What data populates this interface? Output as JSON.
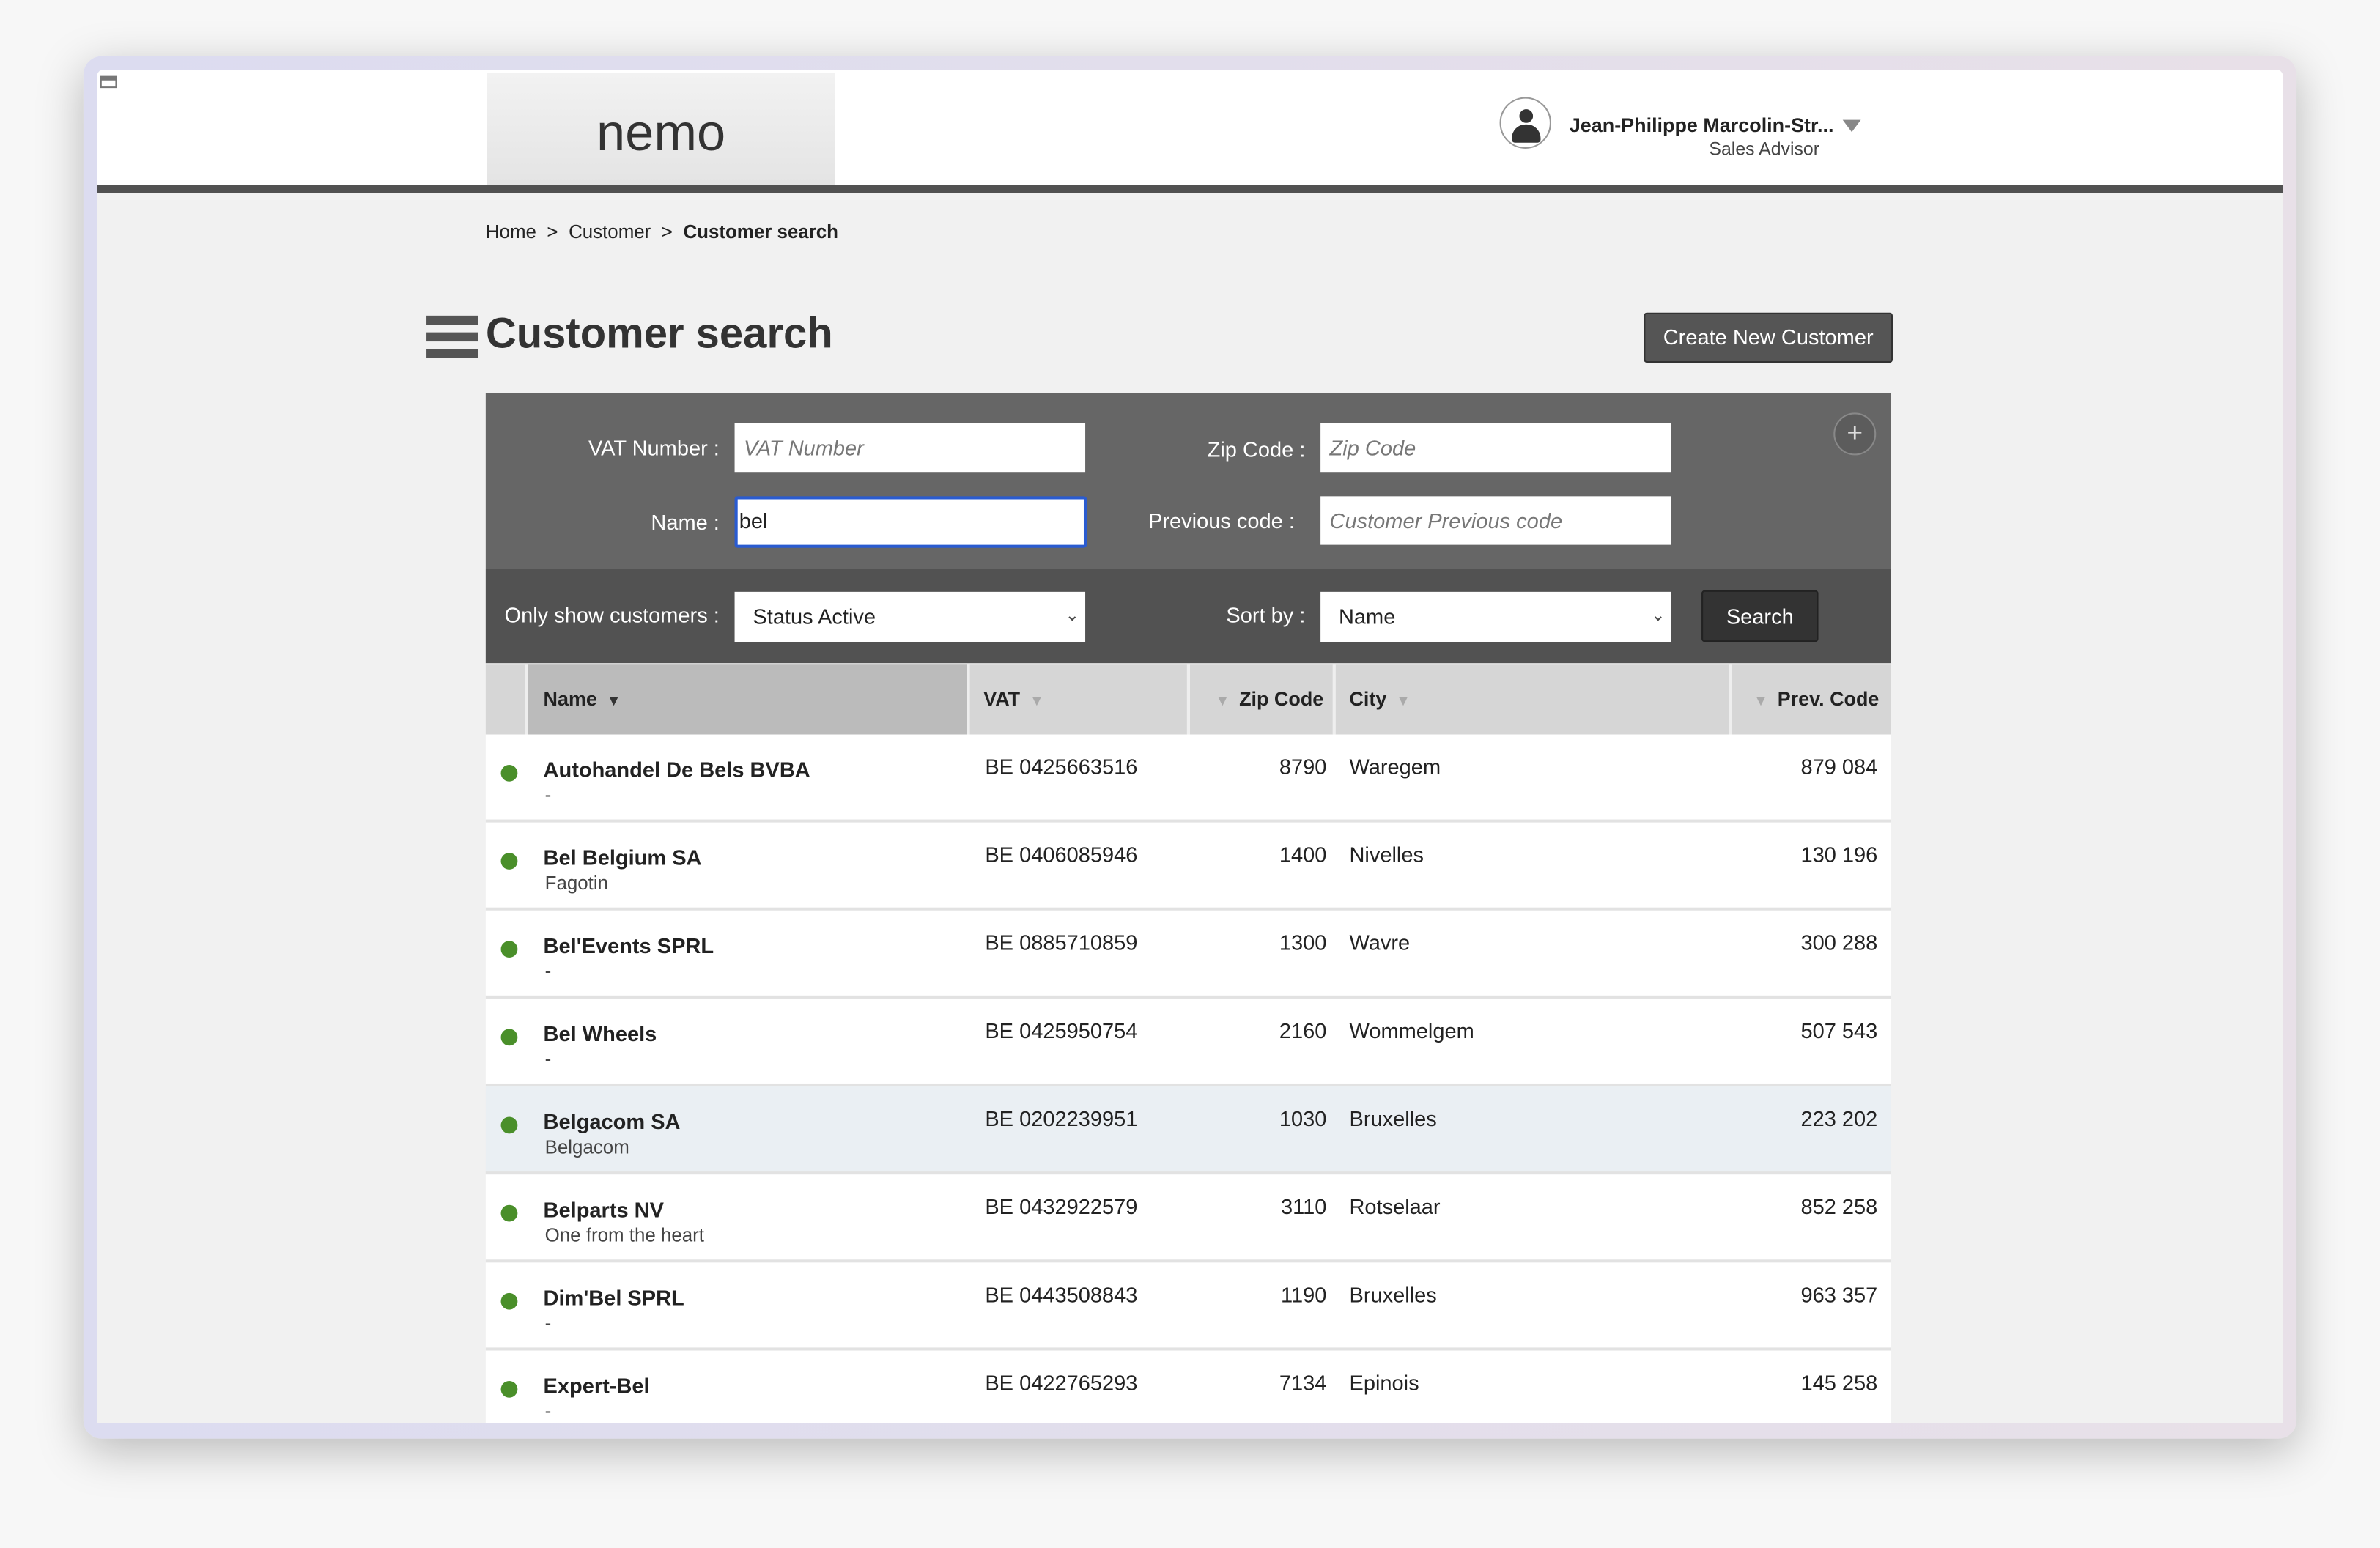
{
  "header": {
    "logo": "nemo",
    "user_name": "Jean-Philippe Marcolin-Str...",
    "user_role": "Sales Advisor"
  },
  "breadcrumb": [
    "Home",
    "Customer",
    "Customer search"
  ],
  "breadcrumb_sep": ">",
  "page_title": "Customer search",
  "create_button": "Create New Customer",
  "filters": {
    "vat_label": "VAT Number :",
    "vat_placeholder": "VAT Number",
    "zip_label": "Zip Code :",
    "zip_placeholder": "Zip Code",
    "name_label": "Name :",
    "name_value": "bel",
    "prev_label": "Previous code :",
    "prev_placeholder": "Customer Previous code",
    "status_label": "Only show customers :",
    "status_value": "Status Active",
    "sort_label": "Sort by :",
    "sort_value": "Name",
    "search_button": "Search",
    "expand_icon": "+"
  },
  "table": {
    "columns": [
      "Name",
      "VAT",
      "Zip Code",
      "City",
      "Prev. Code"
    ],
    "status_color": "#4a8f2a",
    "rows": [
      {
        "name": "Autohandel De Bels BVBA",
        "sub": "-",
        "vat": "BE 0425663516",
        "zip": "8790",
        "city": "Waregem",
        "prev": "879 084"
      },
      {
        "name": "Bel Belgium SA",
        "sub": "Fagotin",
        "vat": "BE 0406085946",
        "zip": "1400",
        "city": "Nivelles",
        "prev": "130 196"
      },
      {
        "name": "Bel'Events SPRL",
        "sub": "-",
        "vat": "BE 0885710859",
        "zip": "1300",
        "city": "Wavre",
        "prev": "300 288"
      },
      {
        "name": "Bel Wheels",
        "sub": "-",
        "vat": "BE 0425950754",
        "zip": "2160",
        "city": "Wommelgem",
        "prev": "507 543"
      },
      {
        "name": "Belgacom SA",
        "sub": "Belgacom",
        "vat": "BE 0202239951",
        "zip": "1030",
        "city": "Bruxelles",
        "prev": "223 202"
      },
      {
        "name": "Belparts NV",
        "sub": "One from the heart",
        "vat": "BE 0432922579",
        "zip": "3110",
        "city": "Rotselaar",
        "prev": "852 258"
      },
      {
        "name": "Dim'Bel SPRL",
        "sub": "-",
        "vat": "BE 0443508843",
        "zip": "1190",
        "city": "Bruxelles",
        "prev": "963 357"
      },
      {
        "name": "Expert-Bel",
        "sub": "-",
        "vat": "BE 0422765293",
        "zip": "7134",
        "city": "Epinois",
        "prev": "145 258"
      }
    ]
  }
}
